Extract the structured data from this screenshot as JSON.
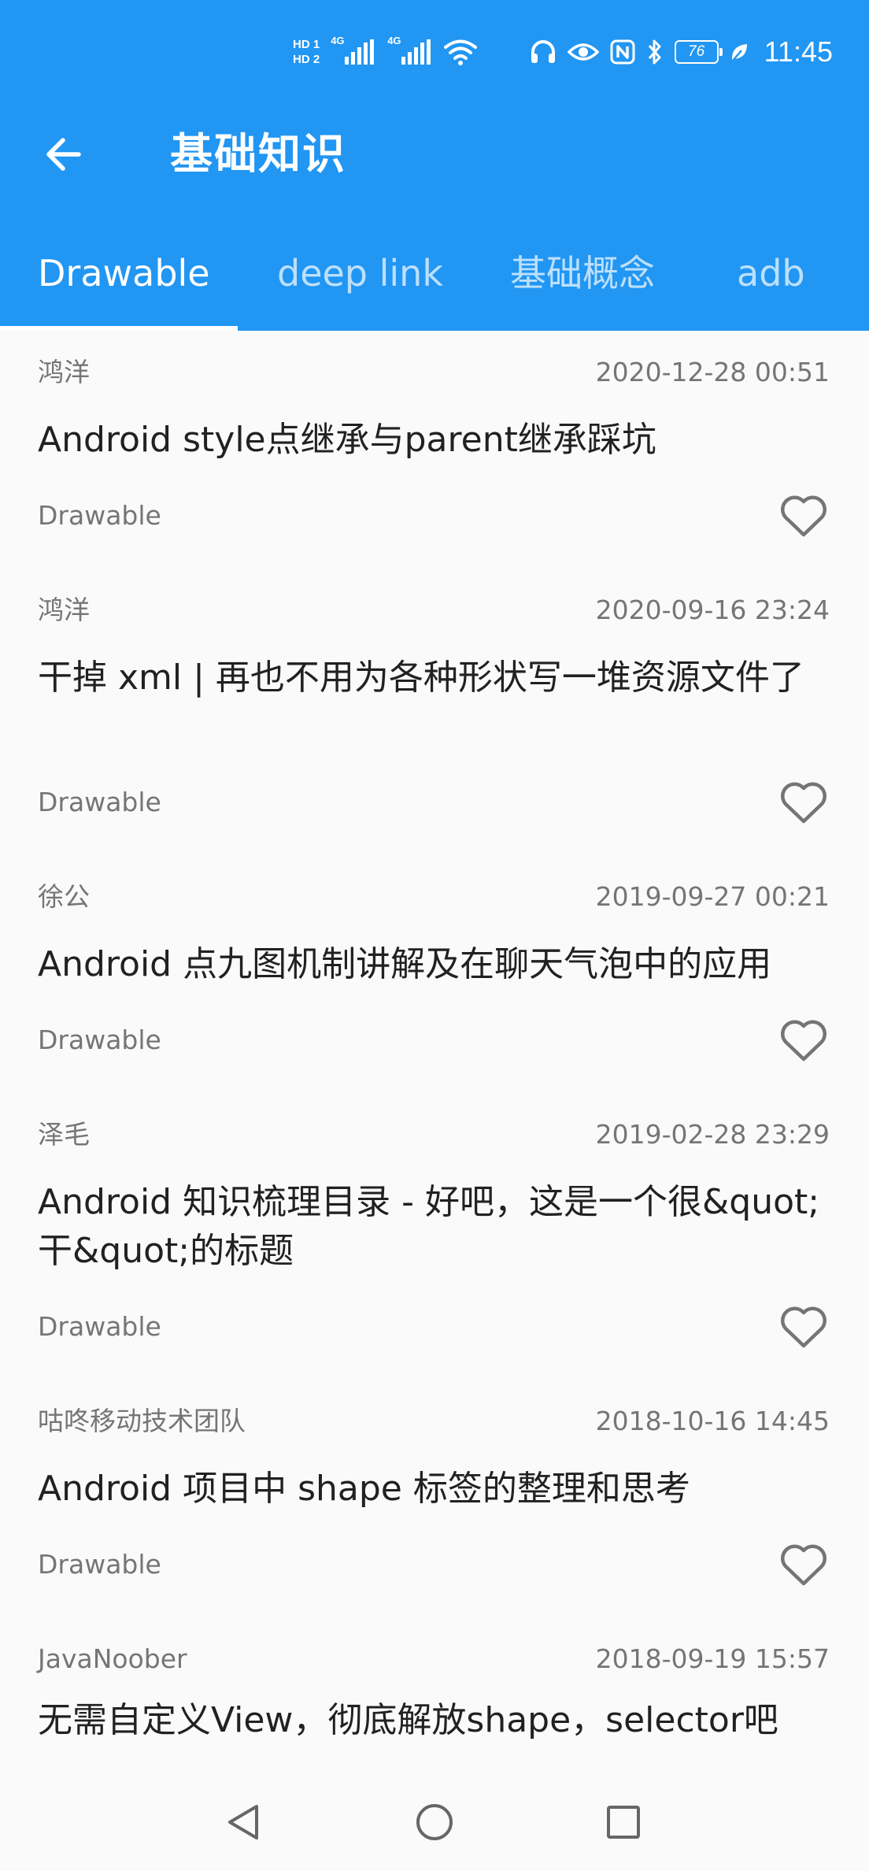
{
  "status_bar": {
    "sim1": "HD 1",
    "sim2": "HD 2",
    "net1": "4G",
    "net2": "4G",
    "battery": "76",
    "time": "11:45"
  },
  "toolbar": {
    "title": "基础知识",
    "back_icon": "arrow-left-icon"
  },
  "tabs": [
    {
      "label": "Drawable",
      "active": true
    },
    {
      "label": "deep link",
      "active": false
    },
    {
      "label": "基础概念",
      "active": false
    },
    {
      "label": "adb",
      "active": false
    }
  ],
  "articles": [
    {
      "author": "鸿洋",
      "time": "2020-12-28 00:51",
      "title": "Android style点继承与parent继承踩坑",
      "category": "Drawable"
    },
    {
      "author": "鸿洋",
      "time": "2020-09-16 23:24",
      "title": "干掉 xml | 再也不用为各种形状写一堆资源文件了",
      "category": "Drawable"
    },
    {
      "author": "徐公",
      "time": "2019-09-27 00:21",
      "title": "Android 点九图机制讲解及在聊天气泡中的应用",
      "category": "Drawable"
    },
    {
      "author": "泽毛",
      "time": "2019-02-28 23:29",
      "title": "Android 知识梳理目录 - 好吧，这是一个很&quot;干&quot;的标题",
      "category": "Drawable"
    },
    {
      "author": "咕咚移动技术团队",
      "time": "2018-10-16 14:45",
      "title": "Android 项目中 shape 标签的整理和思考",
      "category": "Drawable"
    },
    {
      "author": "JavaNoober",
      "time": "2018-09-19 15:57",
      "title": "无需自定义View，彻底解放shape，selector吧",
      "category": "Drawable"
    }
  ],
  "colors": {
    "primary": "#2196f3",
    "background": "#fafafa",
    "title_text": "#212121",
    "secondary_text": "#757575",
    "icon_gray": "#757575"
  },
  "nav_bar": {
    "back": "nav-back-icon",
    "home": "nav-home-icon",
    "recents": "nav-recents-icon"
  }
}
